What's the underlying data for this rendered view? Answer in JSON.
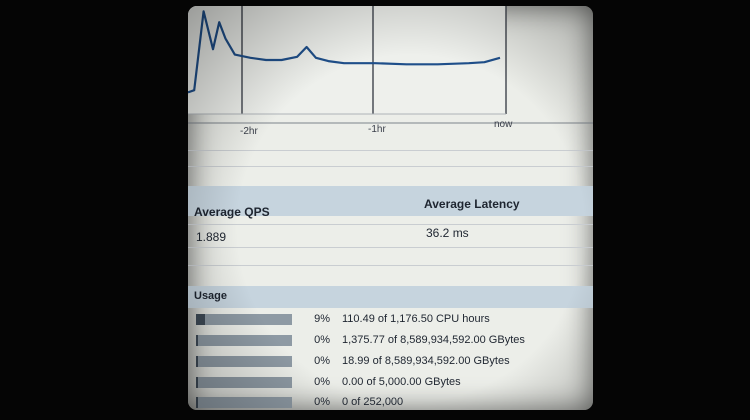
{
  "chart": {
    "x_ticks": [
      "-2hr",
      "-1hr",
      "now"
    ],
    "line_color": "#1f4f8a"
  },
  "chart_data": {
    "type": "line",
    "x": [
      0,
      0.02,
      0.05,
      0.08,
      0.1,
      0.12,
      0.15,
      0.2,
      0.25,
      0.3,
      0.35,
      0.38,
      0.41,
      0.45,
      0.5,
      0.6,
      0.7,
      0.8,
      0.9,
      0.95,
      1.0
    ],
    "values": [
      0.2,
      0.22,
      0.95,
      0.6,
      0.85,
      0.7,
      0.55,
      0.52,
      0.5,
      0.5,
      0.53,
      0.62,
      0.52,
      0.49,
      0.47,
      0.47,
      0.46,
      0.46,
      0.47,
      0.48,
      0.52
    ],
    "x_tick_labels": [
      "-2hr",
      "-1hr",
      "now"
    ],
    "grid": true
  },
  "metrics": {
    "qps_label": "Average QPS",
    "qps_value": "1.889",
    "latency_label": "Average Latency",
    "latency_value": "36.2 ms"
  },
  "usage": {
    "heading": "Usage",
    "rows": [
      {
        "percent": "9%",
        "fill": 0.09,
        "detail": "110.49 of 1,176.50 CPU hours"
      },
      {
        "percent": "0%",
        "fill": 0.0,
        "detail": "1,375.77 of 8,589,934,592.00 GBytes"
      },
      {
        "percent": "0%",
        "fill": 0.0,
        "detail": "18.99 of 8,589,934,592.00 GBytes"
      },
      {
        "percent": "0%",
        "fill": 0.0,
        "detail": "0.00 of 5,000.00 GBytes"
      },
      {
        "percent": "0%",
        "fill": 0.0,
        "detail": "0 of 252,000"
      }
    ]
  }
}
